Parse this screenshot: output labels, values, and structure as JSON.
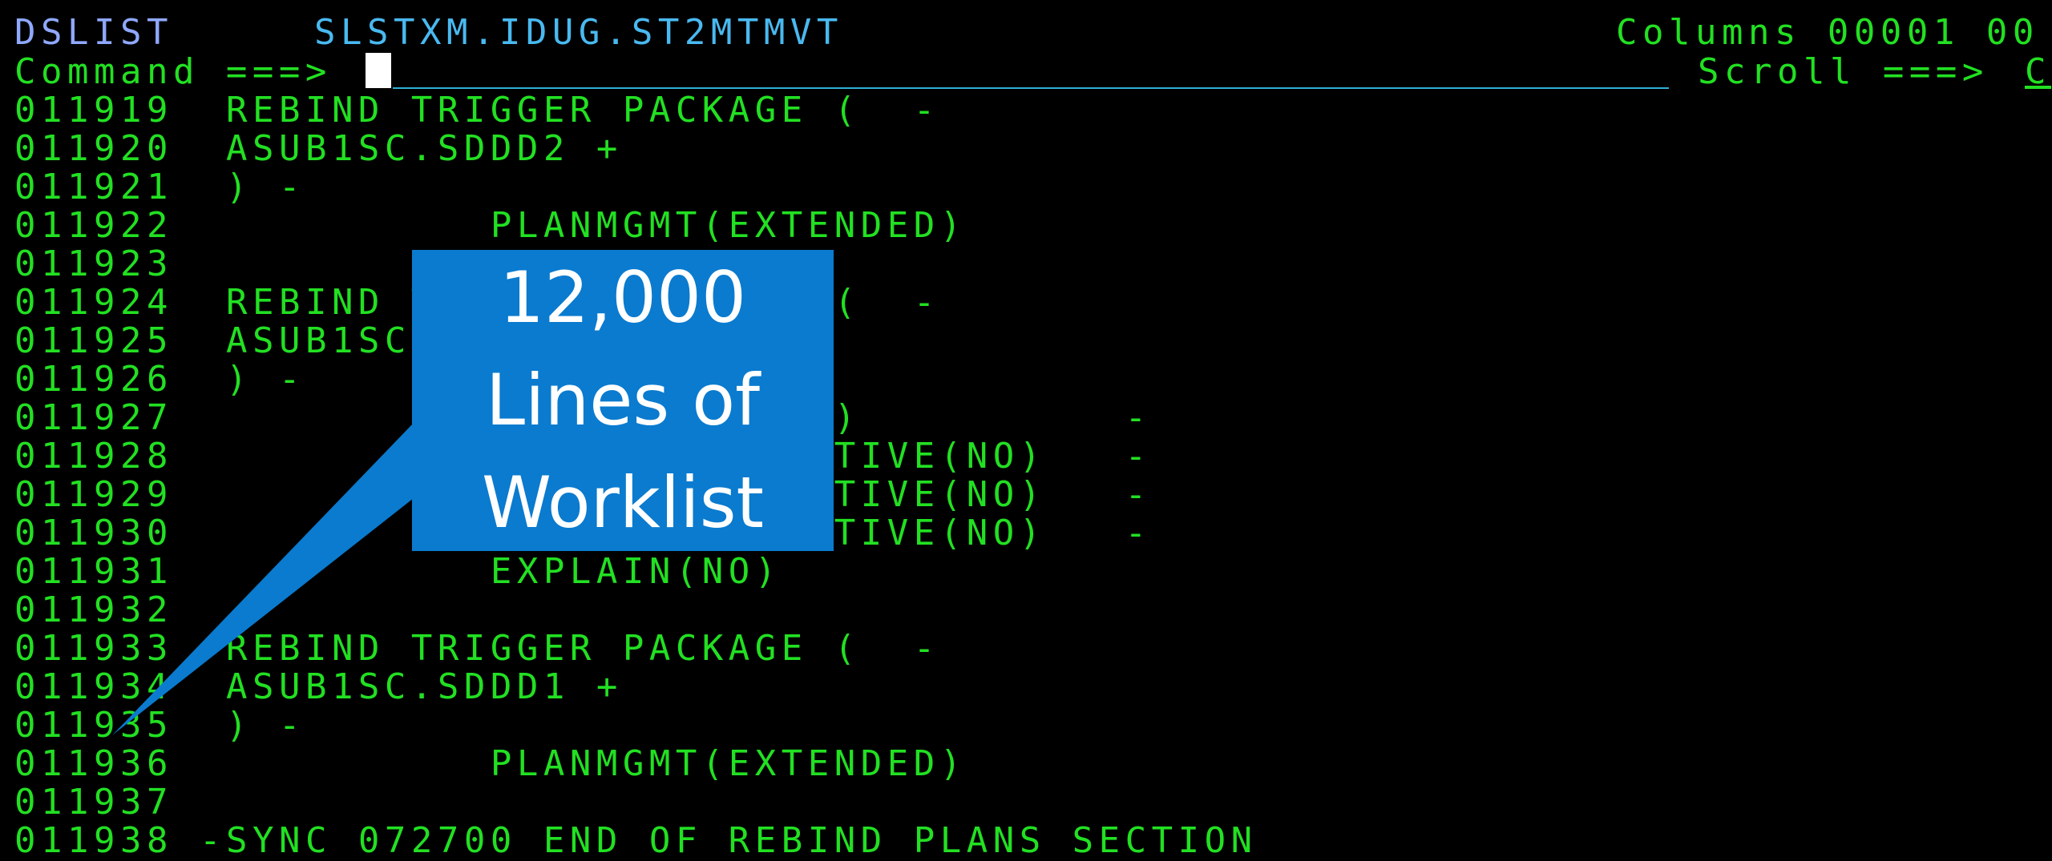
{
  "header": {
    "app_label": "DSLIST",
    "dataset": "SLSTXM.IDUG.ST2MTMVT",
    "columns_label": "Columns 00001 00",
    "command_label": "Command ===>",
    "scroll_label": "Scroll ===>",
    "scroll_value": "C"
  },
  "lines": [
    {
      "num": "011919",
      "text": "  REBIND TRIGGER PACKAGE (  -"
    },
    {
      "num": "011920",
      "text": "  ASUB1SC.SDDD2 +"
    },
    {
      "num": "011921",
      "text": "  ) -"
    },
    {
      "num": "011922",
      "text": "            PLANMGMT(EXTENDED)"
    },
    {
      "num": "011923",
      "text": ""
    },
    {
      "num": "011924",
      "text": "  REBIND TRIGGER PACKAGE (  -"
    },
    {
      "num": "011925",
      "text": "  ASUB1SC"
    },
    {
      "num": "011926",
      "text": "  ) -"
    },
    {
      "num": "011927",
      "text": "                       NE)          -"
    },
    {
      "num": "011928",
      "text": "                       SITIVE(NO)   -"
    },
    {
      "num": "011929",
      "text": "                       SITIVE(NO)   -"
    },
    {
      "num": "011930",
      "text": "                       SITIVE(NO)   -"
    },
    {
      "num": "011931",
      "text": "            EXPLAIN(NO)"
    },
    {
      "num": "011932",
      "text": ""
    },
    {
      "num": "011933",
      "text": "  REBIND TRIGGER PACKAGE (  -"
    },
    {
      "num": "011934",
      "text": "  ASUB1SC.SDDD1 +"
    },
    {
      "num": "011935",
      "text": "  ) -"
    },
    {
      "num": "011936",
      "text": "            PLANMGMT(EXTENDED)"
    },
    {
      "num": "011937",
      "text": ""
    },
    {
      "num": "011938",
      "text": " -SYNC 072700 END OF REBIND PLANS SECTION"
    }
  ],
  "callout": {
    "line1": "12,000",
    "line2": "Lines of",
    "line3": "Worklist"
  },
  "colors": {
    "background": "#000000",
    "text_green": "#22e022",
    "dataset_cyan": "#49b9f0",
    "callout_blue": "#0a7bcf"
  }
}
